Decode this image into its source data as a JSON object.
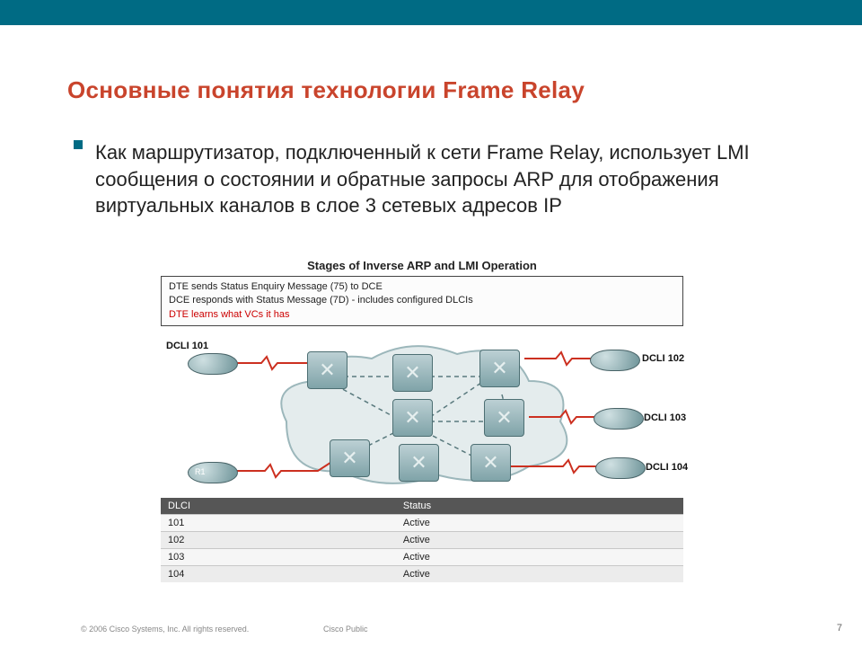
{
  "slide": {
    "title": "Основные понятия технологии Frame Relay",
    "body": "Как маршрутизатор, подключенный к сети Frame Relay, использует LMI сообщения о состоянии и обратные запросы ARP для отображения виртуальных каналов в слое 3 сетевых адресов IP"
  },
  "figure": {
    "caption": "Stages of Inverse ARP and LMI Operation",
    "messages": {
      "line1": "DTE sends Status Enquiry Message (75) to DCE",
      "line2": "DCE responds with Status Message (7D) - includes configured DLCIs",
      "line3": "DTE learns what VCs it has"
    },
    "labels": {
      "dlci101": "DCLI 101",
      "dlci102": "DCLI 102",
      "dlci103": "DCLI 103",
      "dlci104": "DCLI 104",
      "r1": "R1"
    },
    "table": {
      "headers": {
        "dlci": "DLCI",
        "status": "Status"
      },
      "rows": [
        {
          "dlci": "101",
          "status": "Active"
        },
        {
          "dlci": "102",
          "status": "Active"
        },
        {
          "dlci": "103",
          "status": "Active"
        },
        {
          "dlci": "104",
          "status": "Active"
        }
      ]
    }
  },
  "footer": {
    "copyright": "© 2006 Cisco Systems, Inc. All rights reserved.",
    "center": "Cisco Public",
    "page": "7"
  }
}
